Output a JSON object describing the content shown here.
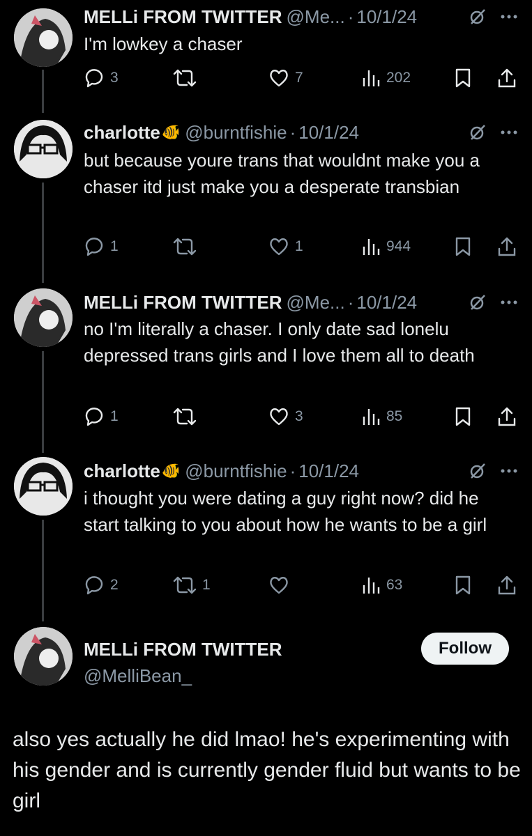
{
  "tweets": [
    {
      "name": "MELLi FROM TWITTER",
      "handle": "@Me...",
      "dot": "·",
      "date": "10/1/24",
      "text": "I'm lowkey a chaser",
      "replies": "3",
      "retweets": "",
      "likes": "7",
      "views": "202"
    },
    {
      "name": "charlotte",
      "emoji": "🐠",
      "handle": "@burntfishie",
      "dot": "·",
      "date": "10/1/24",
      "text": "but because youre trans that wouldnt make you a chaser itd just make you a desperate transbian",
      "replies": "1",
      "retweets": "",
      "likes": "1",
      "views": "944"
    },
    {
      "name": "MELLi FROM TWITTER",
      "handle": "@Me...",
      "dot": "·",
      "date": "10/1/24",
      "text": "no I'm literally a chaser. I only date sad lonelu depressed trans girls and I love them all to death",
      "replies": "1",
      "retweets": "",
      "likes": "3",
      "views": "85"
    },
    {
      "name": "charlotte",
      "emoji": "🐠",
      "handle": "@burntfishie",
      "dot": "·",
      "date": "10/1/24",
      "text": "i thought you were dating a guy right now? did he start talking to you about how he wants to be a girl",
      "replies": "2",
      "retweets": "1",
      "likes": "",
      "views": "63"
    }
  ],
  "main_tweet": {
    "name": "MELLi FROM TWITTER",
    "handle": "@MelliBean_",
    "follow_label": "Follow",
    "text": "also yes actually he did lmao! he's experimenting with his gender and is currently gender fluid but wants to be girl"
  },
  "colors": {
    "background": "#000000",
    "text": "#e7e9ea",
    "muted": "#8b98a5",
    "thread_line": "#3a3d40",
    "follow_bg": "#eff3f4"
  },
  "icons": [
    "reply-icon",
    "retweet-icon",
    "like-icon",
    "views-icon",
    "bookmark-icon",
    "share-icon",
    "grok-icon",
    "more-icon"
  ]
}
